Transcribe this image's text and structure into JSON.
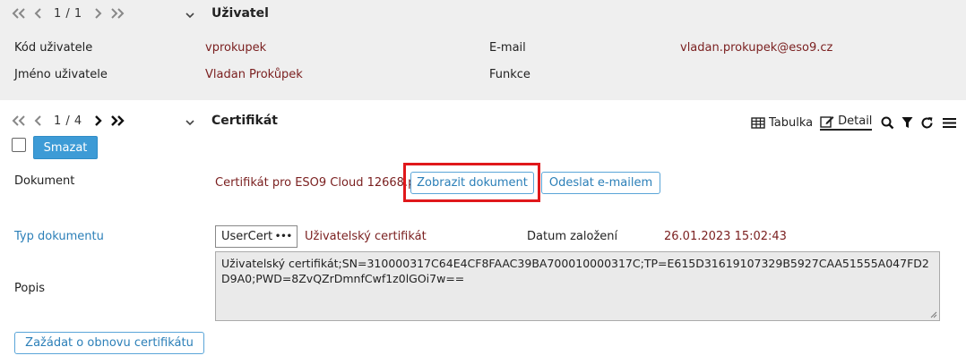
{
  "user_section": {
    "nav_count": "1 / 1",
    "title": "Uživatel",
    "fields": {
      "code_label": "Kód uživatele",
      "code_value": "vprokupek",
      "name_label": "Jméno uživatele",
      "name_value": "Vladan Prokůpek",
      "email_label": "E-mail",
      "email_value": "vladan.prokupek@eso9.cz",
      "function_label": "Funkce"
    }
  },
  "cert_section": {
    "nav_count": "1 / 4",
    "title": "Certifikát",
    "toolbar": {
      "table_label": "Tabulka",
      "detail_label": "Detail"
    },
    "delete_label": "Smazat",
    "document_label": "Dokument",
    "document_value": "Certifikát pro ESO9 Cloud 12668.pf",
    "show_document_label": "Zobrazit dokument",
    "send_email_label": "Odeslat e-mailem",
    "doc_type_label": "Typ dokumentu",
    "doc_type_code": "UserCert",
    "doc_type_more": "•••",
    "doc_type_name": "Uživatelský certifikát",
    "created_label": "Datum založení",
    "created_value": "26.01.2023 15:02:43",
    "description_label": "Popis",
    "description_value": "Uživatelský certifikát;SN=310000317C64E4CF8FAAC39BA700010000317C;TP=E615D31619107329B5927CAA51555A047FD2D9A0;PWD=8ZvQZrDmnfCwf1z0lGOi7w==",
    "renew_label": "Zažádat o obnovu certifikátu"
  },
  "colors": {
    "accent": "#3d9bd6",
    "value_text": "#7a1f1f",
    "link_label": "#2b7fb8",
    "highlight": "#e0181b",
    "panel_bg": "#efefef"
  }
}
